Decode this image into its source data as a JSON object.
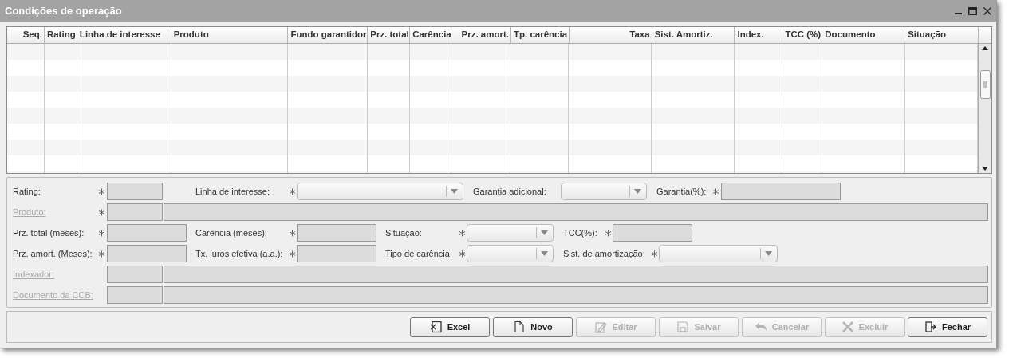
{
  "window": {
    "title": "Condições de operação"
  },
  "table": {
    "columns": [
      {
        "label": "Seq."
      },
      {
        "label": "Rating"
      },
      {
        "label": "Linha de interesse"
      },
      {
        "label": "Produto"
      },
      {
        "label": "Fundo garantidor"
      },
      {
        "label": "Prz. total"
      },
      {
        "label": "Carência"
      },
      {
        "label": "Prz. amort."
      },
      {
        "label": "Tp. carência"
      },
      {
        "label": "Taxa"
      },
      {
        "label": "Sist. Amortiz."
      },
      {
        "label": "Index."
      },
      {
        "label": "TCC (%)"
      },
      {
        "label": "Documento"
      },
      {
        "label": "Situação"
      }
    ]
  },
  "form": {
    "rows": [
      {
        "items": [
          {
            "kind": "label",
            "text": "Rating:",
            "disabled": false
          },
          {
            "kind": "required"
          },
          {
            "kind": "field"
          },
          {
            "kind": "label",
            "text": "Linha de interesse:",
            "disabled": false
          },
          {
            "kind": "required"
          },
          {
            "kind": "combo"
          },
          {
            "kind": "label",
            "text": "Garantia adicional:",
            "disabled": false
          },
          {
            "kind": "combo"
          },
          {
            "kind": "label",
            "text": "Garantia(%):",
            "disabled": false
          },
          {
            "kind": "required"
          },
          {
            "kind": "field"
          }
        ]
      },
      {
        "items": [
          {
            "kind": "label",
            "text": "Produto:",
            "disabled": true
          },
          {
            "kind": "required"
          },
          {
            "kind": "field"
          },
          {
            "kind": "field"
          }
        ]
      },
      {
        "items": [
          {
            "kind": "label",
            "text": "Prz. total (meses):",
            "disabled": false
          },
          {
            "kind": "required"
          },
          {
            "kind": "field"
          },
          {
            "kind": "label",
            "text": "Carência (meses):",
            "disabled": false
          },
          {
            "kind": "required"
          },
          {
            "kind": "field"
          },
          {
            "kind": "label",
            "text": "Situação:",
            "disabled": false
          },
          {
            "kind": "required"
          },
          {
            "kind": "combo"
          },
          {
            "kind": "label",
            "text": "TCC(%):",
            "disabled": false
          },
          {
            "kind": "required"
          },
          {
            "kind": "field"
          }
        ]
      },
      {
        "items": [
          {
            "kind": "label",
            "text": "Prz. amort. (Meses):",
            "disabled": false
          },
          {
            "kind": "required"
          },
          {
            "kind": "field"
          },
          {
            "kind": "label",
            "text": "Tx. juros efetiva (a.a.):",
            "disabled": false
          },
          {
            "kind": "required"
          },
          {
            "kind": "field"
          },
          {
            "kind": "label",
            "text": "Tipo de carência:",
            "disabled": false
          },
          {
            "kind": "required"
          },
          {
            "kind": "combo"
          },
          {
            "kind": "label",
            "text": "Sist. de amortização:",
            "disabled": false
          },
          {
            "kind": "required"
          },
          {
            "kind": "combo"
          }
        ]
      },
      {
        "items": [
          {
            "kind": "label",
            "text": "Indexador:",
            "disabled": true
          },
          {
            "kind": "field"
          },
          {
            "kind": "field"
          }
        ]
      },
      {
        "items": [
          {
            "kind": "label",
            "text": "Documento da CCB:",
            "disabled": true
          },
          {
            "kind": "field"
          },
          {
            "kind": "field"
          }
        ]
      }
    ]
  },
  "buttons": [
    {
      "label": "Excel",
      "kind": "excel",
      "disabled": false
    },
    {
      "label": "Novo",
      "kind": "new",
      "disabled": false
    },
    {
      "label": "Editar",
      "kind": "edit",
      "disabled": true
    },
    {
      "label": "Salvar",
      "kind": "save",
      "disabled": true
    },
    {
      "label": "Cancelar",
      "kind": "cancel",
      "disabled": true
    },
    {
      "label": "Excluir",
      "kind": "delete",
      "disabled": true
    },
    {
      "label": "Fechar",
      "kind": "close",
      "disabled": false
    }
  ]
}
